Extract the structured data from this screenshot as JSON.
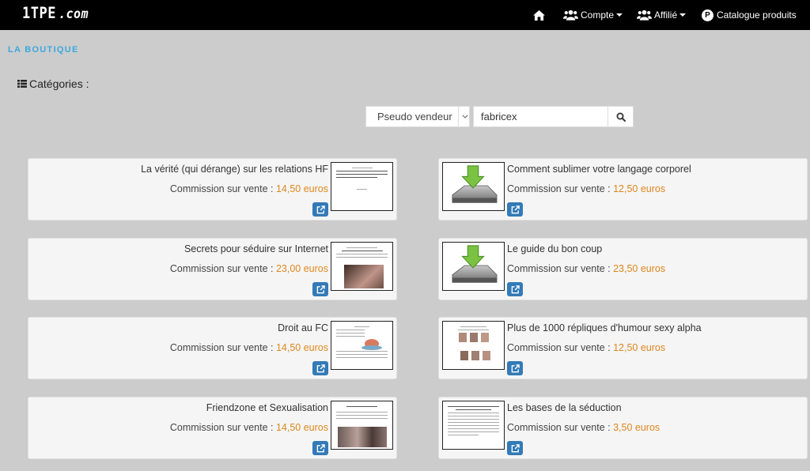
{
  "navbar": {
    "brand_main": "1TPE",
    "brand_dom": ".com",
    "compte_label": "Compte",
    "affilie_label": "Affilié",
    "catalogue_label": "Catalogue produits",
    "catalogue_badge": "P"
  },
  "page": {
    "boutique_title": "LA BOUTIQUE",
    "categories_label": "Catégories :"
  },
  "search": {
    "select_value": "Pseudo vendeur",
    "input_value": "fabricex"
  },
  "products": {
    "commission_label": "Commission sur vente :",
    "items": [
      {
        "title": "La vérité (qui dérange) sur les relations HF",
        "commission": "14,50 euros"
      },
      {
        "title": "Comment sublimer votre langage corporel",
        "commission": "12,50 euros"
      },
      {
        "title": "Secrets pour séduire sur Internet",
        "commission": "23,00 euros"
      },
      {
        "title": "Le guide du bon coup",
        "commission": "23,50 euros"
      },
      {
        "title": "Droit au FC",
        "commission": "14,50 euros"
      },
      {
        "title": "Plus de 1000 répliques d'humour sexy alpha",
        "commission": "12,50 euros"
      },
      {
        "title": "Friendzone et Sexualisation",
        "commission": "14,50 euros"
      },
      {
        "title": "Les bases de la séduction",
        "commission": "3,50 euros"
      }
    ]
  },
  "colors": {
    "accent": "#3ca7dd",
    "commission": "#e0871f",
    "button": "#337ab7"
  }
}
